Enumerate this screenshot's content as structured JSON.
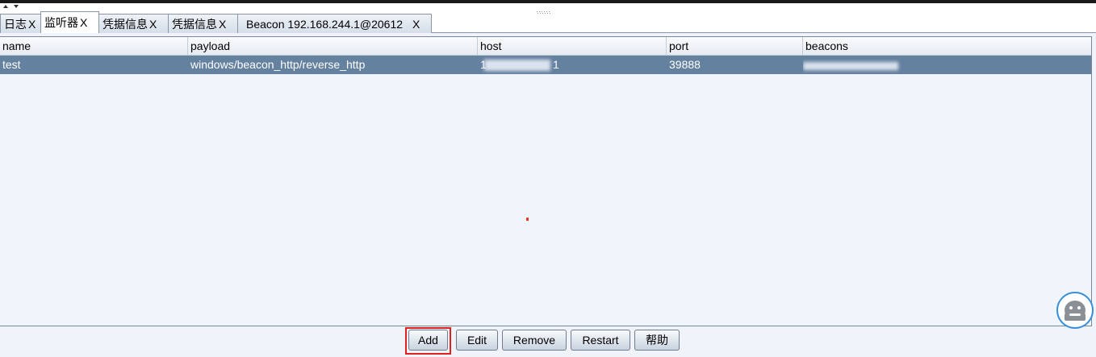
{
  "tabs": [
    {
      "label": "日志",
      "close": "X",
      "active": false
    },
    {
      "label": "监听器",
      "close": "X",
      "active": true
    },
    {
      "label": "凭据信息",
      "close": "X",
      "active": false
    },
    {
      "label": "凭据信息",
      "close": "X",
      "active": false
    },
    {
      "label": "Beacon 192.168.244.1@20612",
      "close": "X",
      "active": false
    }
  ],
  "table": {
    "columns": [
      "name",
      "payload",
      "host",
      "port",
      "beacons"
    ],
    "rows": [
      {
        "name": "test",
        "payload": "windows/beacon_http/reverse_http",
        "host_visible_start": "1",
        "host_visible_end": "1",
        "port": "39888",
        "beacons": ""
      }
    ],
    "selected_row_color": "#6581a0"
  },
  "buttons": {
    "add": "Add",
    "edit": "Edit",
    "remove": "Remove",
    "restart": "Restart",
    "help": "帮助"
  },
  "colors": {
    "highlight_frame": "#e0201a",
    "tab_border": "#8b97a6",
    "panel_bg": "#f0f4fb"
  }
}
